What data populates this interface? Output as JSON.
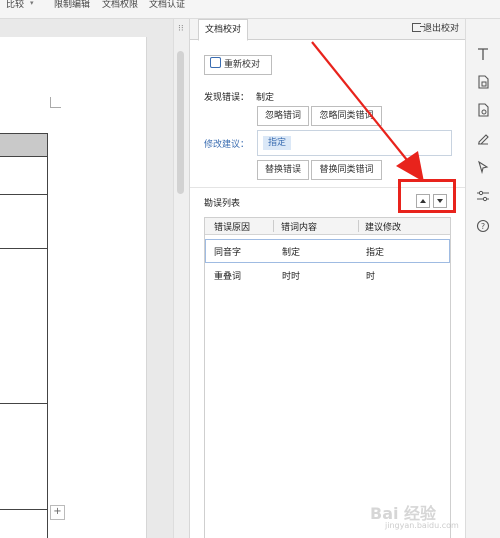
{
  "topbar": {
    "items": [
      "比较",
      "限制编辑",
      "文档权限",
      "文档认证"
    ]
  },
  "panel": {
    "tab_label": "文档校对",
    "exit_label": "退出校对",
    "recheck_label": "重新校对",
    "found_error_label": "发现错误：",
    "found_error_value": "制定",
    "ignore_word_label": "忽略错词",
    "ignore_similar_label": "忽略同类错词",
    "suggest_label": "修改建议：",
    "suggest_value": "指定",
    "replace_label": "替换错误",
    "replace_similar_label": "替换同类错词",
    "list_title": "勘误列表",
    "columns": [
      "错误原因",
      "错词内容",
      "建议修改"
    ],
    "rows": [
      {
        "reason": "同音字",
        "word": "制定",
        "suggest": "指定"
      },
      {
        "reason": "重叠词",
        "word": "时时",
        "suggest": "时"
      }
    ]
  },
  "watermark": {
    "text": "Bai 经验",
    "sub": "jingyan.baidu.com"
  },
  "colors": {
    "accent": "#3b6db1",
    "highlight": "#e8231c",
    "selected_row_border": "#9fbbe2"
  },
  "icons": [
    "text-icon",
    "document-icon",
    "document-settings-icon",
    "pen-icon",
    "cursor-icon",
    "sliders-icon",
    "help-icon"
  ]
}
